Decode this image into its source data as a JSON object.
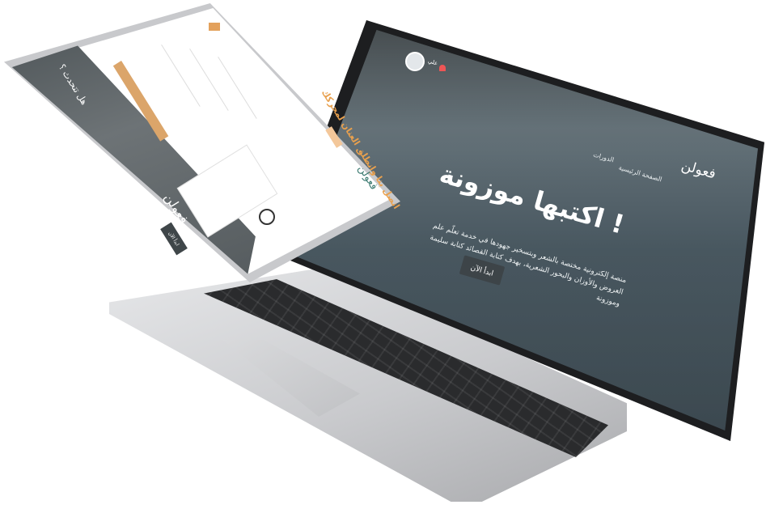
{
  "laptop": {
    "nav": {
      "brand": "فعولن",
      "links": [
        "الصفحة الرئيسية",
        "الدورات"
      ],
      "user_name": "علي",
      "icons": [
        "bell-icon",
        "avatar"
      ]
    },
    "hero": {
      "title": "اكتبها موزونة !",
      "subtitle": "منصة إلكترونية مختصة بالشعر وبتسخير جهودها في خدمة تعلّم علم العروض والأوزان والبحور الشعرية، بهدف كتابة القصائد كتابة سليمة وموزونة",
      "cta": "ابدأ الآن"
    }
  },
  "tablet": {
    "sidebar": {
      "brand": "فعولن",
      "question": "هل تتحدث ؟",
      "cta": "ابدأ الآن"
    },
    "main": {
      "logo": "فعولن",
      "heading": "اتصل بنا وانطلق العنان لمحركك",
      "icons": [
        "headset-icon"
      ]
    },
    "colors": {
      "accent": "#e8a04e",
      "brand_green": "#3b7a70",
      "hero_dark": "#3d4448"
    }
  }
}
